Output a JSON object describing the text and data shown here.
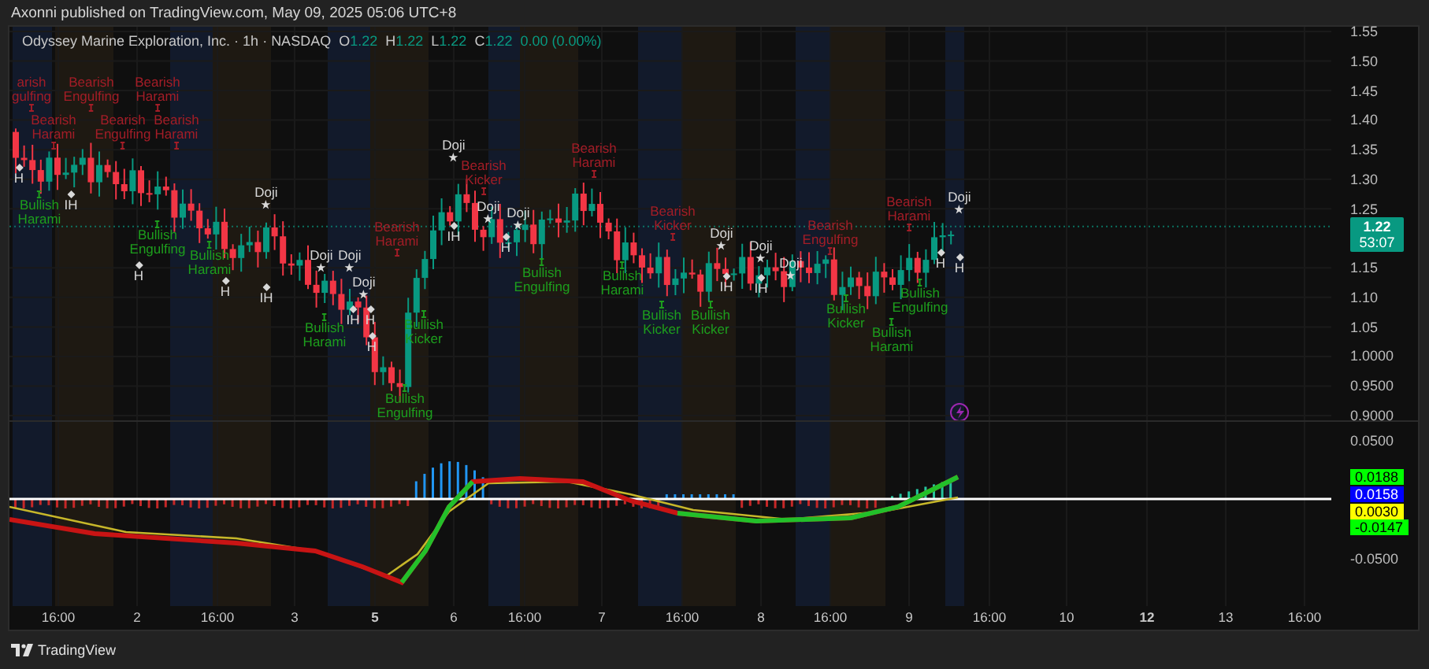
{
  "header": {
    "publisher_line": "Axonni published on TradingView.com, May 09, 2025 05:06 UTC+8"
  },
  "legend": {
    "symbol": "Odyssey Marine Exploration, Inc. · 1h · NASDAQ",
    "ohlc": [
      {
        "label": "O",
        "value": "1.22"
      },
      {
        "label": "H",
        "value": "1.22"
      },
      {
        "label": "L",
        "value": "1.22"
      },
      {
        "label": "C",
        "value": "1.22"
      }
    ],
    "change": "0.00 (0.00%)"
  },
  "price_axis": {
    "ticks": [
      "1.55",
      "1.50",
      "1.45",
      "1.40",
      "1.35",
      "1.30",
      "1.25",
      "1.15",
      "1.10",
      "1.05",
      "1.0000",
      "0.9500",
      "0.9000"
    ],
    "last_price": "1.22",
    "countdown": "53:07"
  },
  "indicator_axis": {
    "ticks": [
      "0.0500",
      "-0.0500"
    ],
    "badges": [
      {
        "value": "0.0188",
        "color": "#00ff00"
      },
      {
        "value": "0.0158",
        "color": "#0000ff"
      },
      {
        "value": "0.0030",
        "color": "#ffff00"
      },
      {
        "value": "-0.0147",
        "color": "#00ff00"
      }
    ]
  },
  "pattern_labels": [
    {
      "text": "arish gulfing",
      "kind": "bearish"
    },
    {
      "text": "Bearish Harami",
      "kind": "bearish"
    },
    {
      "text": "Bearish Engulfing",
      "kind": "bearish"
    },
    {
      "text": "Bearish Engulfing",
      "kind": "bearish"
    },
    {
      "text": "Bearish Harami",
      "kind": "bearish"
    },
    {
      "text": "Bearish Harami",
      "kind": "bearish"
    },
    {
      "text": "H",
      "kind": "h"
    },
    {
      "text": "Bullish Harami",
      "kind": "bullish"
    },
    {
      "text": "IH",
      "kind": "h"
    },
    {
      "text": "Bullish Engulfing",
      "kind": "bullish"
    },
    {
      "text": "H",
      "kind": "h"
    },
    {
      "text": "Bullish Harami",
      "kind": "bullish"
    },
    {
      "text": "Doji",
      "kind": "doji"
    },
    {
      "text": "H",
      "kind": "h"
    },
    {
      "text": "IH",
      "kind": "h"
    },
    {
      "text": "Doji",
      "kind": "doji"
    },
    {
      "text": "Doji",
      "kind": "doji"
    },
    {
      "text": "Doji",
      "kind": "doji"
    },
    {
      "text": "Bullish Harami",
      "kind": "bullish"
    },
    {
      "text": "IH",
      "kind": "h"
    },
    {
      "text": "H",
      "kind": "h"
    },
    {
      "text": "H",
      "kind": "h"
    },
    {
      "text": "Bearish Harami",
      "kind": "bearish"
    },
    {
      "text": "Bullish Kicker",
      "kind": "bullish"
    },
    {
      "text": "Bullish Engulfing",
      "kind": "bullish"
    },
    {
      "text": "Doji",
      "kind": "doji"
    },
    {
      "text": "IH",
      "kind": "h"
    },
    {
      "text": "Bearish Kicker",
      "kind": "bearish"
    },
    {
      "text": "Doji",
      "kind": "doji"
    },
    {
      "text": "Doji",
      "kind": "doji"
    },
    {
      "text": "H",
      "kind": "h"
    },
    {
      "text": "Bullish Engulfing",
      "kind": "bullish"
    },
    {
      "text": "Bearish Harami",
      "kind": "bearish"
    },
    {
      "text": "Bullish Harami",
      "kind": "bullish"
    },
    {
      "text": "Bearish Kicker",
      "kind": "bearish"
    },
    {
      "text": "Bullish Kicker",
      "kind": "bullish"
    },
    {
      "text": "Doji",
      "kind": "doji"
    },
    {
      "text": "IH",
      "kind": "h"
    },
    {
      "text": "Bullish Kicker",
      "kind": "bullish"
    },
    {
      "text": "Doji",
      "kind": "doji"
    },
    {
      "text": "IH",
      "kind": "h"
    },
    {
      "text": "Doji",
      "kind": "doji"
    },
    {
      "text": "Bearish Engulfing",
      "kind": "bearish"
    },
    {
      "text": "Bullish Kicker",
      "kind": "bullish"
    },
    {
      "text": "Bearish Harami",
      "kind": "bearish"
    },
    {
      "text": "Bullish Harami",
      "kind": "bullish"
    },
    {
      "text": "H",
      "kind": "h"
    },
    {
      "text": "Bullish Engulfing",
      "kind": "bullish"
    },
    {
      "text": "Doji",
      "kind": "doji"
    },
    {
      "text": "H",
      "kind": "h"
    }
  ],
  "time_axis": [
    {
      "label": "16:00",
      "bold": false
    },
    {
      "label": "2",
      "bold": false
    },
    {
      "label": "16:00",
      "bold": false
    },
    {
      "label": "3",
      "bold": false
    },
    {
      "label": "5",
      "bold": true
    },
    {
      "label": "6",
      "bold": false
    },
    {
      "label": "16:00",
      "bold": false
    },
    {
      "label": "7",
      "bold": false
    },
    {
      "label": "16:00",
      "bold": false
    },
    {
      "label": "8",
      "bold": false
    },
    {
      "label": "16:00",
      "bold": false
    },
    {
      "label": "9",
      "bold": false
    },
    {
      "label": "16:00",
      "bold": false
    },
    {
      "label": "10",
      "bold": false
    },
    {
      "label": "12",
      "bold": true
    },
    {
      "label": "13",
      "bold": false
    },
    {
      "label": "16:00",
      "bold": false
    }
  ],
  "footer": {
    "brand": "TradingView"
  }
}
